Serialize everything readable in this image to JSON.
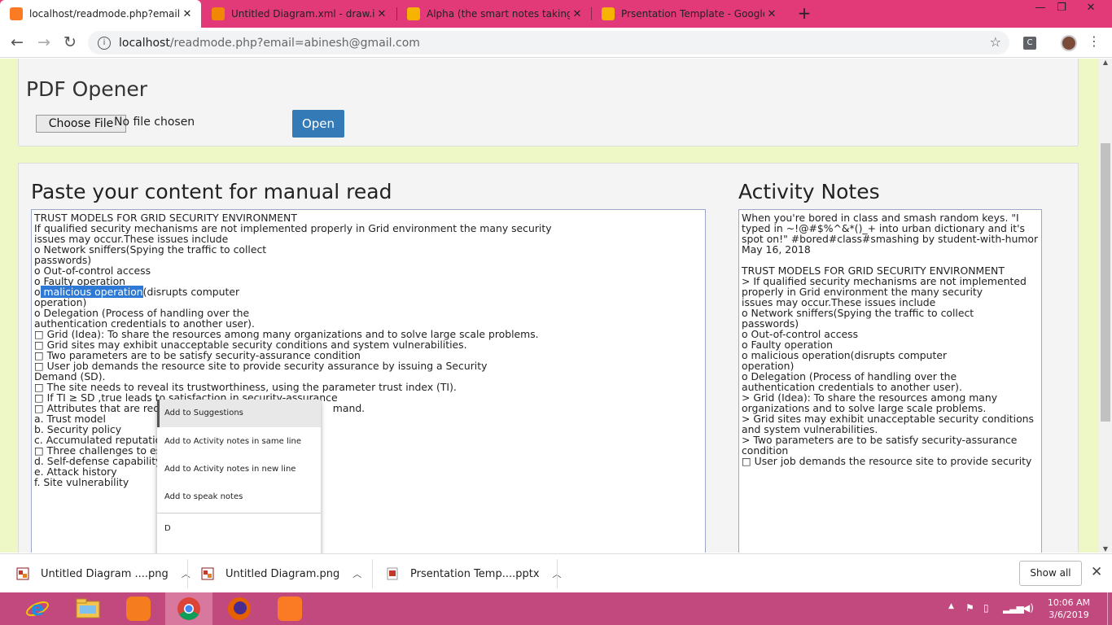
{
  "browser": {
    "tabs": [
      {
        "title": "localhost/readmode.php?email=a",
        "active": true,
        "icon": "xampp-icon"
      },
      {
        "title": "Untitled Diagram.xml - draw.io",
        "active": false,
        "icon": "drawio-icon"
      },
      {
        "title": "Alpha (the smart notes taking we",
        "active": false,
        "icon": "slides-icon"
      },
      {
        "title": "Prsentation Template - Google S",
        "active": false,
        "icon": "slides-icon"
      }
    ],
    "url_host": "localhost",
    "url_rest": "/readmode.php?email=abinesh@gmail.com",
    "extension_letter": "C"
  },
  "pdf_opener": {
    "title": "PDF Opener",
    "choose_label": "Choose File",
    "no_file": "No file chosen",
    "open_label": "Open"
  },
  "manual_read": {
    "title": "Paste your content for manual read",
    "lines_before": [
      "TRUST MODELS FOR GRID SECURITY ENVIRONMENT",
      "If qualified security mechanisms are not implemented properly in Grid environment the many security",
      "issues may occur.These issues include",
      "o Network sniffers(Spying the traffic to collect",
      "passwords)",
      "o Out-of-control access",
      "o Faulty operation"
    ],
    "hl_prefix": "o",
    "hl_text": " malicious operation",
    "hl_suffix": "(disrupts computer",
    "lines_after": [
      "operation)",
      "o Delegation (Process of handling over the",
      "authentication credentials to another user).",
      "□ Grid (Idea): To share the resources among many organizations and to solve large scale problems.",
      "□ Grid sites may exhibit unacceptable security conditions and system vulnerabilities.",
      "□ Two parameters are to be satisfy security-assurance condition",
      "□ User job demands the resource site to provide security assurance by issuing a Security",
      "Demand (SD).",
      "□ The site needs to reveal its trustworthiness, using the parameter trust index (TI).",
      "□ If TI ≥ SD ,true leads to satisfaction in security-assurance",
      "□ Attributes that are requ                                                    mand.",
      "a. Trust model",
      "b. Security policy",
      "c. Accumulated reputation(meaning belief)",
      "□ Three challenges to establish the trust among grids",
      "d. Self-defense capability",
      "e. Attack history",
      "f. Site vulnerability"
    ]
  },
  "context_menu": {
    "items": [
      "Add to Suggestions",
      "Add to Activity notes in same line",
      "Add to Activity notes in new line",
      "Add to speak notes"
    ],
    "extra": "D"
  },
  "activity_notes": {
    "title": "Activity Notes",
    "lines": [
      "When you're bored in class and smash random keys. \"I",
      "typed in ~!@#$%^&*()_+ into urban dictionary and it's",
      "spot on!\" #bored#class#smashing by student-with-humor",
      "May 16, 2018",
      "",
      "TRUST MODELS FOR GRID SECURITY ENVIRONMENT",
      "> If qualified security mechanisms are not implemented",
      "properly in Grid environment the many security",
      "issues may occur.These issues include",
      "o Network sniffers(Spying the traffic to collect",
      "passwords)",
      "o Out-of-control access",
      "o Faulty operation",
      "o malicious operation(disrupts computer",
      "operation)",
      "o Delegation (Process of handling over the",
      "authentication credentials to another user).",
      "> Grid (Idea): To share the resources among many",
      "organizations and to solve large scale problems.",
      "> Grid sites may exhibit unacceptable security conditions",
      "and system vulnerabilities.",
      "> Two parameters are to be satisfy security-assurance",
      "condition",
      "□ User job demands the resource site to provide security"
    ]
  },
  "downloads": {
    "items": [
      "Untitled Diagram ....png",
      "Untitled Diagram.png",
      "Prsentation Temp....pptx"
    ],
    "show_all": "Show all"
  },
  "taskbar": {
    "time": "10:06 AM",
    "date": "3/6/2019"
  }
}
